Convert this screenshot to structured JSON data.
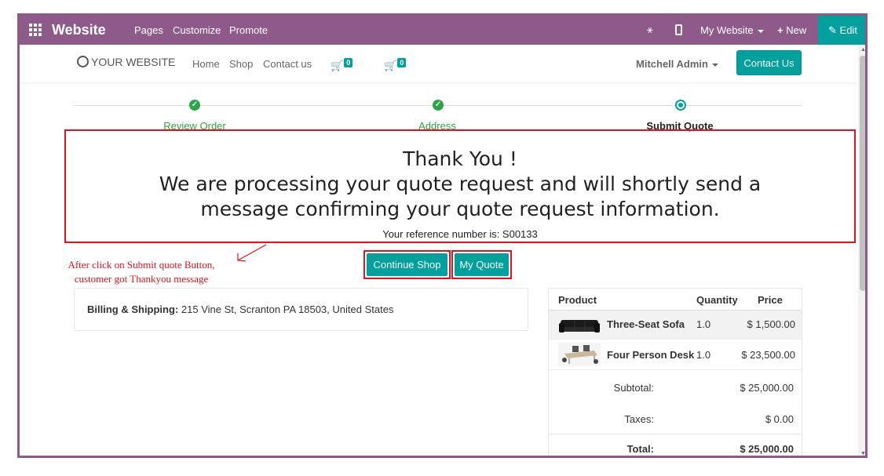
{
  "topbar": {
    "brand": "Website",
    "menu": [
      "Pages",
      "Customize",
      "Promote"
    ],
    "site_label": "My Website",
    "new_label": "New",
    "edit_label": "Edit"
  },
  "navbar": {
    "logo": "YOUR WEBSITE",
    "links": [
      "Home",
      "Shop",
      "Contact us"
    ],
    "cart_count": "0",
    "quote_count": "0",
    "user": "Mitchell Admin",
    "contact_button": "Contact Us"
  },
  "steps": [
    {
      "label": "Review Order",
      "state": "done"
    },
    {
      "label": "Address",
      "state": "done"
    },
    {
      "label": "Submit Quote",
      "state": "current"
    }
  ],
  "thanks": {
    "title": "Thank You !",
    "message": "We are processing your quote request and will shortly send a message confirming your quote request information.",
    "reference": "Your reference number is: S00133"
  },
  "annotation": {
    "line1": "After click on Submit quote Button,",
    "line2": "customer got Thankyou message"
  },
  "actions": {
    "continue_shop": "Continue Shop",
    "my_quote": "My Quote"
  },
  "billing": {
    "label": "Billing & Shipping:",
    "address": "215 Vine St, Scranton PA 18503, United States"
  },
  "order": {
    "headers": {
      "product": "Product",
      "quantity": "Quantity",
      "price": "Price"
    },
    "items": [
      {
        "name": "Three-Seat Sofa",
        "qty": "1.0",
        "price": "$ 1,500.00"
      },
      {
        "name": "Four Person Desk",
        "qty": "1.0",
        "price": "$ 23,500.00"
      }
    ],
    "subtotal_label": "Subtotal:",
    "subtotal": "$ 25,000.00",
    "taxes_label": "Taxes:",
    "taxes": "$ 0.00",
    "total_label": "Total:",
    "total": "$ 25,000.00"
  },
  "colors": {
    "topbar": "#8e5a8a",
    "accent": "#00a09d",
    "success": "#28a745",
    "highlight": "#e0141c"
  }
}
